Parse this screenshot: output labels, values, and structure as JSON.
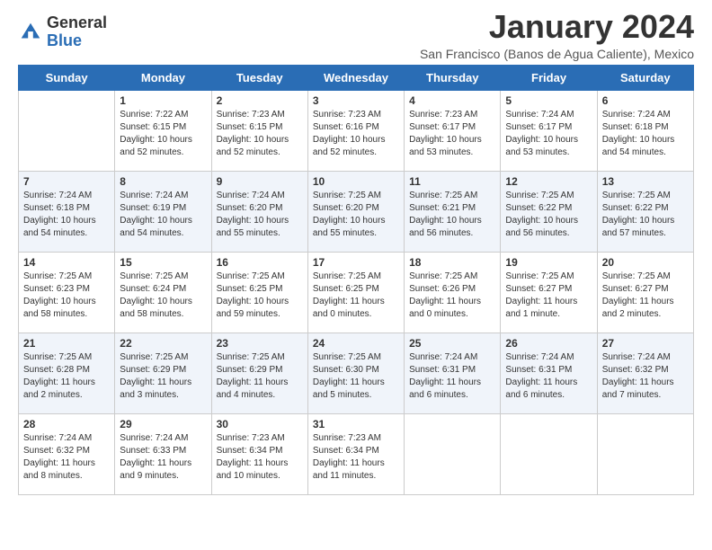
{
  "header": {
    "logo_general": "General",
    "logo_blue": "Blue",
    "month_title": "January 2024",
    "location": "San Francisco (Banos de Agua Caliente), Mexico"
  },
  "weekdays": [
    "Sunday",
    "Monday",
    "Tuesday",
    "Wednesday",
    "Thursday",
    "Friday",
    "Saturday"
  ],
  "weeks": [
    [
      {
        "day": "",
        "sunrise": "",
        "sunset": "",
        "daylight": ""
      },
      {
        "day": "1",
        "sunrise": "Sunrise: 7:22 AM",
        "sunset": "Sunset: 6:15 PM",
        "daylight": "Daylight: 10 hours and 52 minutes."
      },
      {
        "day": "2",
        "sunrise": "Sunrise: 7:23 AM",
        "sunset": "Sunset: 6:15 PM",
        "daylight": "Daylight: 10 hours and 52 minutes."
      },
      {
        "day": "3",
        "sunrise": "Sunrise: 7:23 AM",
        "sunset": "Sunset: 6:16 PM",
        "daylight": "Daylight: 10 hours and 52 minutes."
      },
      {
        "day": "4",
        "sunrise": "Sunrise: 7:23 AM",
        "sunset": "Sunset: 6:17 PM",
        "daylight": "Daylight: 10 hours and 53 minutes."
      },
      {
        "day": "5",
        "sunrise": "Sunrise: 7:24 AM",
        "sunset": "Sunset: 6:17 PM",
        "daylight": "Daylight: 10 hours and 53 minutes."
      },
      {
        "day": "6",
        "sunrise": "Sunrise: 7:24 AM",
        "sunset": "Sunset: 6:18 PM",
        "daylight": "Daylight: 10 hours and 54 minutes."
      }
    ],
    [
      {
        "day": "7",
        "sunrise": "Sunrise: 7:24 AM",
        "sunset": "Sunset: 6:18 PM",
        "daylight": "Daylight: 10 hours and 54 minutes."
      },
      {
        "day": "8",
        "sunrise": "Sunrise: 7:24 AM",
        "sunset": "Sunset: 6:19 PM",
        "daylight": "Daylight: 10 hours and 54 minutes."
      },
      {
        "day": "9",
        "sunrise": "Sunrise: 7:24 AM",
        "sunset": "Sunset: 6:20 PM",
        "daylight": "Daylight: 10 hours and 55 minutes."
      },
      {
        "day": "10",
        "sunrise": "Sunrise: 7:25 AM",
        "sunset": "Sunset: 6:20 PM",
        "daylight": "Daylight: 10 hours and 55 minutes."
      },
      {
        "day": "11",
        "sunrise": "Sunrise: 7:25 AM",
        "sunset": "Sunset: 6:21 PM",
        "daylight": "Daylight: 10 hours and 56 minutes."
      },
      {
        "day": "12",
        "sunrise": "Sunrise: 7:25 AM",
        "sunset": "Sunset: 6:22 PM",
        "daylight": "Daylight: 10 hours and 56 minutes."
      },
      {
        "day": "13",
        "sunrise": "Sunrise: 7:25 AM",
        "sunset": "Sunset: 6:22 PM",
        "daylight": "Daylight: 10 hours and 57 minutes."
      }
    ],
    [
      {
        "day": "14",
        "sunrise": "Sunrise: 7:25 AM",
        "sunset": "Sunset: 6:23 PM",
        "daylight": "Daylight: 10 hours and 58 minutes."
      },
      {
        "day": "15",
        "sunrise": "Sunrise: 7:25 AM",
        "sunset": "Sunset: 6:24 PM",
        "daylight": "Daylight: 10 hours and 58 minutes."
      },
      {
        "day": "16",
        "sunrise": "Sunrise: 7:25 AM",
        "sunset": "Sunset: 6:25 PM",
        "daylight": "Daylight: 10 hours and 59 minutes."
      },
      {
        "day": "17",
        "sunrise": "Sunrise: 7:25 AM",
        "sunset": "Sunset: 6:25 PM",
        "daylight": "Daylight: 11 hours and 0 minutes."
      },
      {
        "day": "18",
        "sunrise": "Sunrise: 7:25 AM",
        "sunset": "Sunset: 6:26 PM",
        "daylight": "Daylight: 11 hours and 0 minutes."
      },
      {
        "day": "19",
        "sunrise": "Sunrise: 7:25 AM",
        "sunset": "Sunset: 6:27 PM",
        "daylight": "Daylight: 11 hours and 1 minute."
      },
      {
        "day": "20",
        "sunrise": "Sunrise: 7:25 AM",
        "sunset": "Sunset: 6:27 PM",
        "daylight": "Daylight: 11 hours and 2 minutes."
      }
    ],
    [
      {
        "day": "21",
        "sunrise": "Sunrise: 7:25 AM",
        "sunset": "Sunset: 6:28 PM",
        "daylight": "Daylight: 11 hours and 2 minutes."
      },
      {
        "day": "22",
        "sunrise": "Sunrise: 7:25 AM",
        "sunset": "Sunset: 6:29 PM",
        "daylight": "Daylight: 11 hours and 3 minutes."
      },
      {
        "day": "23",
        "sunrise": "Sunrise: 7:25 AM",
        "sunset": "Sunset: 6:29 PM",
        "daylight": "Daylight: 11 hours and 4 minutes."
      },
      {
        "day": "24",
        "sunrise": "Sunrise: 7:25 AM",
        "sunset": "Sunset: 6:30 PM",
        "daylight": "Daylight: 11 hours and 5 minutes."
      },
      {
        "day": "25",
        "sunrise": "Sunrise: 7:24 AM",
        "sunset": "Sunset: 6:31 PM",
        "daylight": "Daylight: 11 hours and 6 minutes."
      },
      {
        "day": "26",
        "sunrise": "Sunrise: 7:24 AM",
        "sunset": "Sunset: 6:31 PM",
        "daylight": "Daylight: 11 hours and 6 minutes."
      },
      {
        "day": "27",
        "sunrise": "Sunrise: 7:24 AM",
        "sunset": "Sunset: 6:32 PM",
        "daylight": "Daylight: 11 hours and 7 minutes."
      }
    ],
    [
      {
        "day": "28",
        "sunrise": "Sunrise: 7:24 AM",
        "sunset": "Sunset: 6:32 PM",
        "daylight": "Daylight: 11 hours and 8 minutes."
      },
      {
        "day": "29",
        "sunrise": "Sunrise: 7:24 AM",
        "sunset": "Sunset: 6:33 PM",
        "daylight": "Daylight: 11 hours and 9 minutes."
      },
      {
        "day": "30",
        "sunrise": "Sunrise: 7:23 AM",
        "sunset": "Sunset: 6:34 PM",
        "daylight": "Daylight: 11 hours and 10 minutes."
      },
      {
        "day": "31",
        "sunrise": "Sunrise: 7:23 AM",
        "sunset": "Sunset: 6:34 PM",
        "daylight": "Daylight: 11 hours and 11 minutes."
      },
      {
        "day": "",
        "sunrise": "",
        "sunset": "",
        "daylight": ""
      },
      {
        "day": "",
        "sunrise": "",
        "sunset": "",
        "daylight": ""
      },
      {
        "day": "",
        "sunrise": "",
        "sunset": "",
        "daylight": ""
      }
    ]
  ]
}
